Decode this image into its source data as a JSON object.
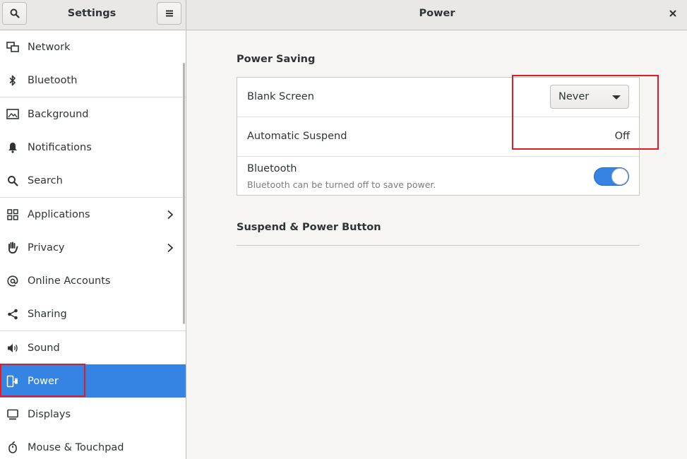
{
  "header": {
    "sidebar_title": "Settings",
    "main_title": "Power",
    "search_icon": "search-icon",
    "menu_icon": "hamburger-menu-icon",
    "close_icon": "close-icon"
  },
  "sidebar": {
    "items": [
      {
        "label": "Network",
        "icon": "network-icon"
      },
      {
        "label": "Bluetooth",
        "icon": "bluetooth-icon"
      },
      {
        "label": "Background",
        "icon": "background-icon"
      },
      {
        "label": "Notifications",
        "icon": "bell-icon"
      },
      {
        "label": "Search",
        "icon": "search-icon"
      },
      {
        "label": "Applications",
        "icon": "grid-icon",
        "chevron": true
      },
      {
        "label": "Privacy",
        "icon": "hand-icon",
        "chevron": true
      },
      {
        "label": "Online Accounts",
        "icon": "at-icon"
      },
      {
        "label": "Sharing",
        "icon": "share-icon"
      },
      {
        "label": "Sound",
        "icon": "speaker-icon"
      },
      {
        "label": "Power",
        "icon": "power-plug-icon",
        "selected": true
      },
      {
        "label": "Displays",
        "icon": "display-icon"
      },
      {
        "label": "Mouse & Touchpad",
        "icon": "mouse-icon"
      }
    ]
  },
  "main": {
    "power_saving_title": "Power Saving",
    "rows": {
      "blank_screen": {
        "title": "Blank Screen",
        "value": "Never"
      },
      "automatic_suspend": {
        "title": "Automatic Suspend",
        "value": "Off"
      },
      "bluetooth": {
        "title": "Bluetooth",
        "subtitle": "Bluetooth can be turned off to save power.",
        "enabled": true
      }
    },
    "suspend_title": "Suspend & Power Button"
  },
  "colors": {
    "accent": "#3584e4",
    "annotation": "#e01b24"
  }
}
